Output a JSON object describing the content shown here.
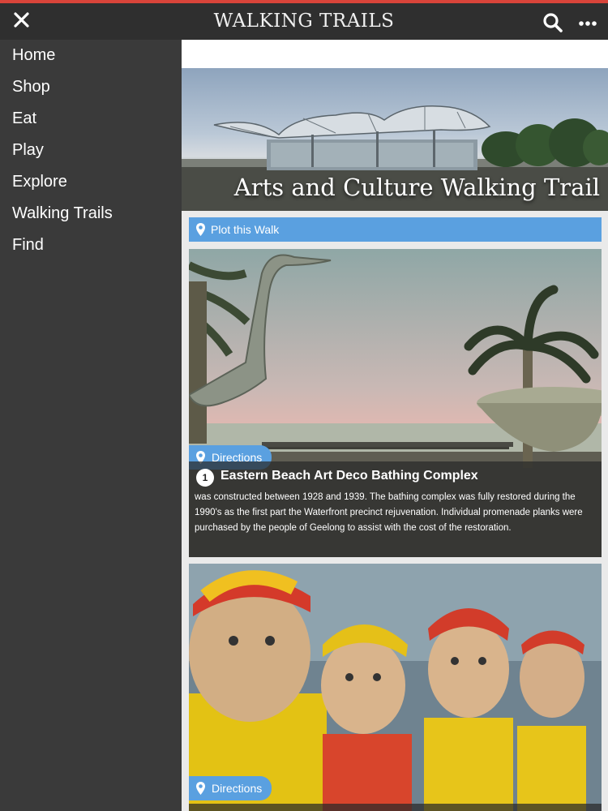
{
  "header": {
    "title": "WALKING TRAILS",
    "close_icon": "close-icon",
    "search_icon": "search-icon",
    "more_icon": "more-icon"
  },
  "sidebar": {
    "items": [
      {
        "label": "Home"
      },
      {
        "label": "Shop"
      },
      {
        "label": "Eat"
      },
      {
        "label": "Play"
      },
      {
        "label": "Explore"
      },
      {
        "label": "Walking Trails"
      },
      {
        "label": "Find"
      }
    ]
  },
  "main": {
    "hero_title": "Arts and Culture Walking Trail",
    "plot_label": "Plot this Walk",
    "stops": [
      {
        "number": "1",
        "directions_label": "Directions",
        "title": "Eastern Beach Art Deco Bathing Complex",
        "description": "was constructed between 1928 and 1939. The bathing complex was fully restored during the 1990's as the first part the Waterfront precinct rejuvenation. Individual promenade planks were purchased by the people of Geelong to assist with the cost of the restoration."
      },
      {
        "directions_label": "Directions"
      }
    ]
  },
  "colors": {
    "accent": "#5aa0e0",
    "topbar": "#2f2f2f",
    "sidebar": "#3a3a3a",
    "stripe": "#d9443a"
  }
}
